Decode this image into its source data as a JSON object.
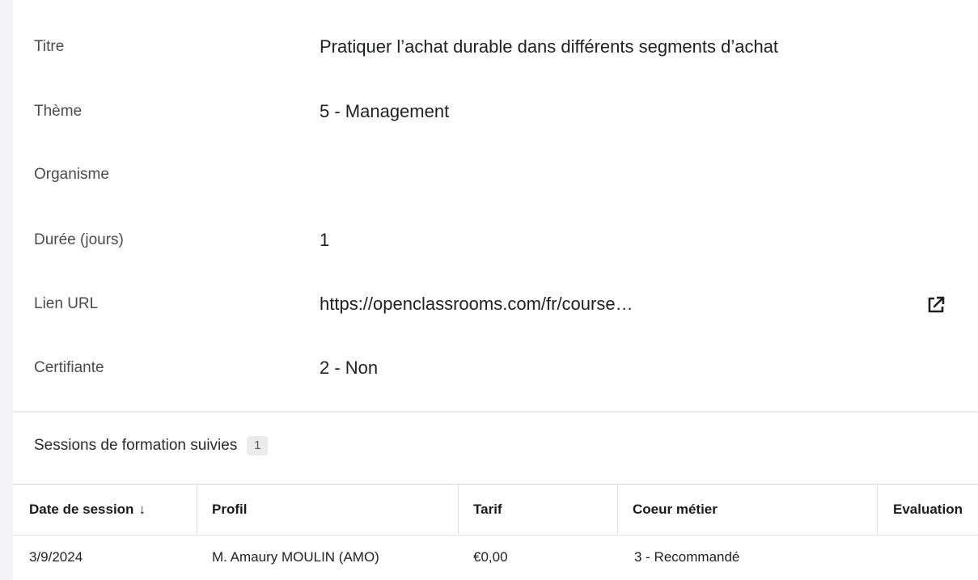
{
  "fields": [
    {
      "label": "Titre",
      "value": "Pratiquer l’achat durable dans différents segments d’achat"
    },
    {
      "label": "Thème",
      "value": "5 - Management"
    },
    {
      "label": "Organisme",
      "value": ""
    },
    {
      "label": "Durée (jours)",
      "value": "1"
    },
    {
      "label": "Lien URL",
      "value": "https://openclassrooms.com/fr/course…",
      "icon": "external-link-icon"
    },
    {
      "label": "Certifiante",
      "value": "2 - Non"
    }
  ],
  "sessions": {
    "title": "Sessions de formation suivies",
    "count": "1",
    "columns": [
      {
        "label": "Date de session",
        "sort": "↓"
      },
      {
        "label": "Profil"
      },
      {
        "label": "Tarif"
      },
      {
        "label": "Coeur métier"
      },
      {
        "label": "Evaluation"
      }
    ],
    "rows": [
      {
        "date": "3/9/2024",
        "profil": "M. Amaury MOULIN (AMO)",
        "tarif": "€0,00",
        "coeur": "3 - Recommandé",
        "evaluation": ""
      }
    ]
  }
}
